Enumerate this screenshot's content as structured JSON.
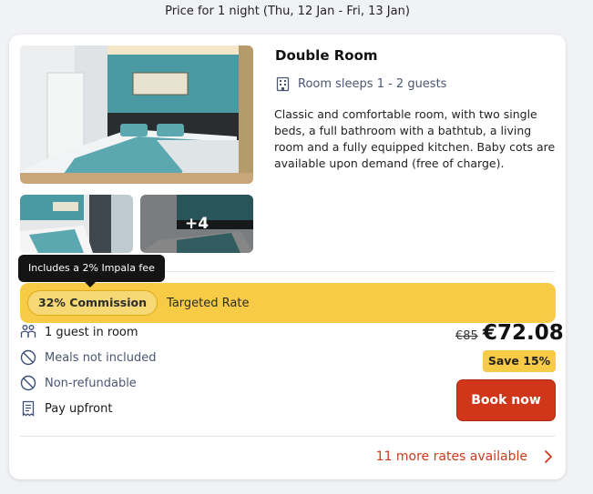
{
  "header": {
    "price_note": "Price for 1 night (Thu, 12 Jan - Fri, 13 Jan)"
  },
  "room": {
    "title": "Double Room",
    "sleeps": "Room sleeps 1 - 2 guests",
    "description": "Classic and comfortable room, with two single beds, a full bathroom with a bathtub, a living room and a fully equipped kitchen. Baby cots are available upon demand (free of charge).",
    "more_photos": "+4"
  },
  "tooltip": {
    "text": "Includes a 2% Impala fee"
  },
  "rate": {
    "commission": "32% Commission",
    "label": "Targeted Rate"
  },
  "features": [
    {
      "icon": "guests-icon",
      "label": "1 guest in room"
    },
    {
      "icon": "no-meals-icon",
      "label": "Meals not included"
    },
    {
      "icon": "non-refundable-icon",
      "label": "Non-refundable"
    },
    {
      "icon": "receipt-icon",
      "label": "Pay upfront"
    }
  ],
  "pricing": {
    "old_price": "€85",
    "new_price": "€72.08",
    "save": "Save 15%"
  },
  "actions": {
    "book": "Book now",
    "more_rates": "11 more rates available"
  },
  "colors": {
    "accent": "#d0361a",
    "highlight": "#f8cb46",
    "muted_text": "#4a5670"
  }
}
